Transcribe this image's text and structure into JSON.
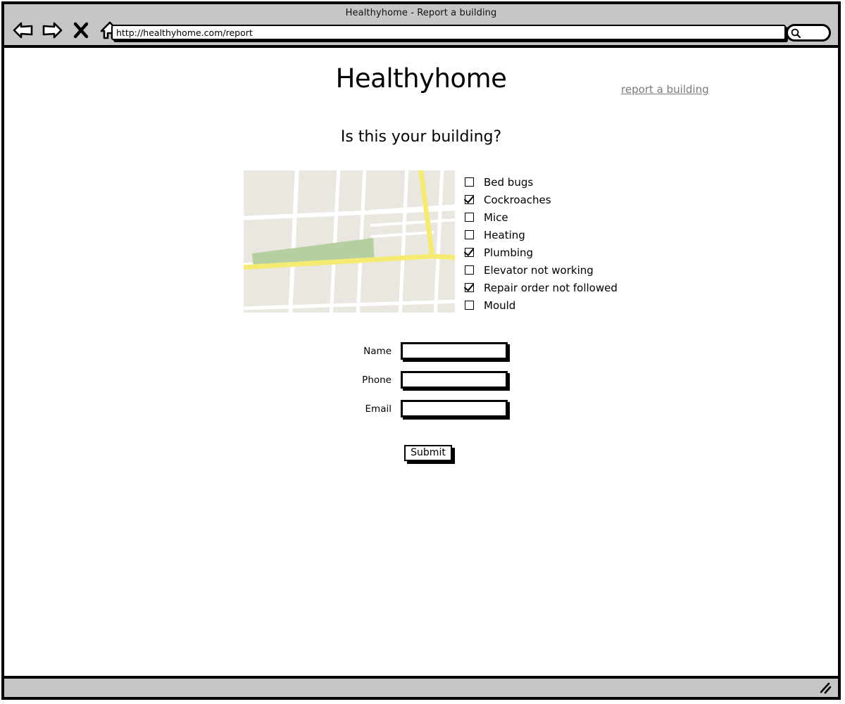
{
  "browser": {
    "window_title": "Healthyhome - Report a building",
    "url": "http://healthyhome.com/report",
    "url_placeholder": "",
    "search_placeholder": "",
    "search_value": "",
    "icons": {
      "back": "back-arrow-icon",
      "forward": "forward-arrow-icon",
      "stop": "close-x-icon",
      "home": "home-icon",
      "search": "search-icon",
      "resize": "resize-grip-icon"
    }
  },
  "header": {
    "site_title": "Healthyhome",
    "nav_link": "report a building"
  },
  "main": {
    "question": "Is this your building?",
    "map": {
      "name": "building-location-map",
      "colors": {
        "background": "#eae7e0",
        "street": "#ffffff",
        "park": "#b5cfa0",
        "highway": "#f6eb72"
      }
    },
    "issues_legend": "",
    "issues": [
      {
        "label": "Bed bugs",
        "checked": false
      },
      {
        "label": "Cockroaches",
        "checked": true
      },
      {
        "label": "Mice",
        "checked": false
      },
      {
        "label": "Heating",
        "checked": false
      },
      {
        "label": "Plumbing",
        "checked": true
      },
      {
        "label": "Elevator not working",
        "checked": false
      },
      {
        "label": "Repair order not followed",
        "checked": true
      },
      {
        "label": "Mould",
        "checked": false
      }
    ],
    "form": {
      "fields": [
        {
          "label": "Name",
          "value": "",
          "placeholder": ""
        },
        {
          "label": "Phone",
          "value": "",
          "placeholder": ""
        },
        {
          "label": "Email",
          "value": "",
          "placeholder": ""
        }
      ],
      "submit_label": "Submit"
    }
  }
}
